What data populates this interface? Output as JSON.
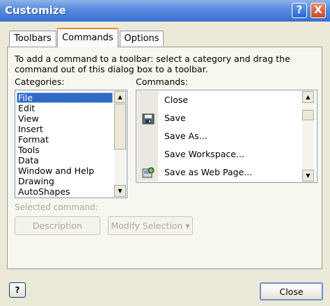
{
  "window": {
    "title": "Customize",
    "help_glyph": "?",
    "close_glyph": "X"
  },
  "tabs": [
    {
      "label": "Toolbars",
      "selected": false
    },
    {
      "label": "Commands",
      "selected": true
    },
    {
      "label": "Options",
      "selected": false
    }
  ],
  "instruction": "To add a command to a toolbar: select a category and drag the command out of this dialog box to a toolbar.",
  "categories": {
    "label": "Categories:",
    "items": [
      "File",
      "Edit",
      "View",
      "Insert",
      "Format",
      "Tools",
      "Data",
      "Window and Help",
      "Drawing",
      "AutoShapes"
    ],
    "selected": "File"
  },
  "commands": {
    "label": "Commands:",
    "items": [
      {
        "label": "Close",
        "icon": ""
      },
      {
        "label": "Save",
        "icon": "save-icon"
      },
      {
        "label": "Save As...",
        "icon": ""
      },
      {
        "label": "Save Workspace...",
        "icon": ""
      },
      {
        "label": "Save as Web Page...",
        "icon": "web-page-icon"
      }
    ]
  },
  "selected_command": {
    "label": "Selected command:",
    "description_button": "Description",
    "modify_button": "Modify Selection ▾"
  },
  "footer": {
    "help_button": "?",
    "close_button": "Close"
  }
}
